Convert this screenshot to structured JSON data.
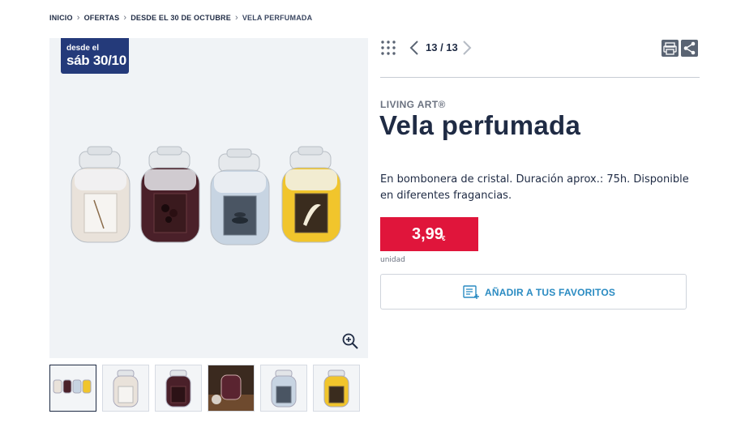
{
  "breadcrumb": {
    "items": [
      "INICIO",
      "OFERTAS",
      "DESDE EL 30 DE OCTUBRE"
    ],
    "current": "VELA PERFUMADA"
  },
  "gallery": {
    "badge": {
      "line1": "desde el",
      "line2": "sáb 30/10"
    },
    "jar_colors": [
      "#e9e2da",
      "#4a2029",
      "#c7d4e2",
      "#f1c52c"
    ],
    "thumbnail_count": 6,
    "active_thumbnail": 1
  },
  "nav": {
    "counter": "13 / 13"
  },
  "product": {
    "brand": "LIVING ART®",
    "title": "Vela perfumada",
    "description": "En bombonera de cristal. Duración aprox.: 75h. Disponible en diferentes fragancias.",
    "price": "3,99",
    "currency": "€",
    "unit": "unidad",
    "favorites_label": "AÑADIR A TUS FAVORITOS"
  },
  "colors": {
    "price_bg": "#e0153b",
    "badge_bg": "#243a7a",
    "link": "#2a8bc2",
    "text": "#1f2b44"
  }
}
